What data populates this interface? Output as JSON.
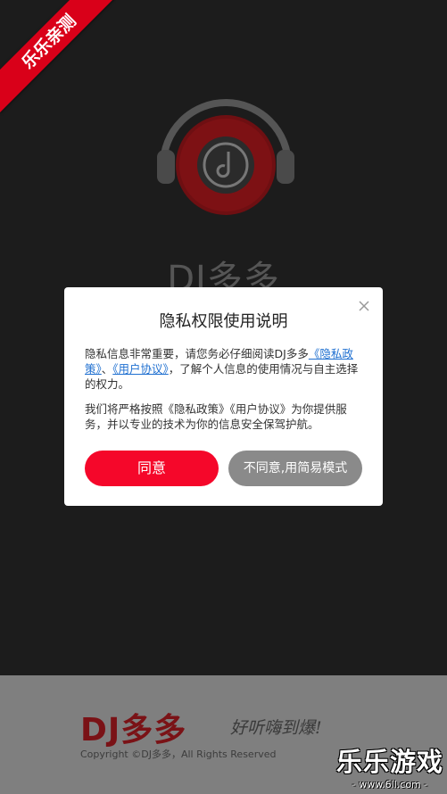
{
  "ribbon": {
    "text": "乐乐亲测"
  },
  "splash": {
    "brand": "DJ多多"
  },
  "dialog": {
    "title": "隐私权限使用说明",
    "p1_a": "隐私信息非常重要，请您务必仔细阅读DJ多多",
    "p1_link1": "《隐私政策》",
    "p1_sep": "、",
    "p1_link2": "《用户协议》",
    "p1_b": "，了解个人信息的使用情况与自主选择的权力。",
    "p2": "我们将严格按照《隐私政策》《用户协议》为你提供服务，并以专业的技术为你的信息安全保驾护航。",
    "agree_label": "同意",
    "disagree_label": "不同意,用简易模式"
  },
  "footer": {
    "logo": "DJ多多",
    "slogan": "好听嗨到爆!",
    "copyright": "Copyright ©DJ多多，All Rights Reserved"
  },
  "watermark": {
    "main": "乐乐游戏",
    "sub": "- www.6ll.com -"
  },
  "colors": {
    "accent": "#f5072a",
    "link": "#1e6fd0",
    "disabled": "#8a8a8a"
  }
}
